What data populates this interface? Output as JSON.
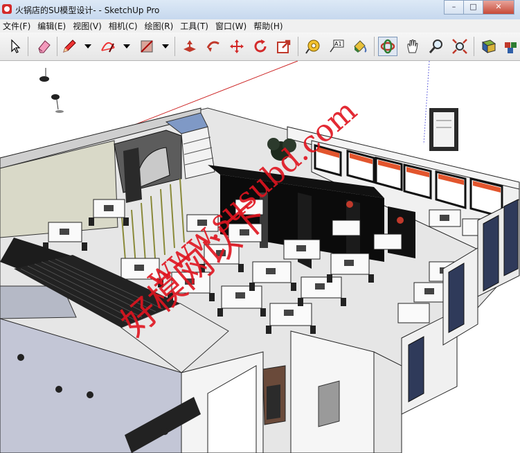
{
  "window": {
    "title": "火锅店的SU模型设计- - SketchUp Pro",
    "minimize_glyph": "–",
    "maximize_glyph": "□",
    "close_glyph": "✕"
  },
  "menu": [
    "文件(F)",
    "编辑(E)",
    "视图(V)",
    "相机(C)",
    "绘图(R)",
    "工具(T)",
    "窗口(W)",
    "帮助(H)"
  ],
  "toolbar": {
    "tools": [
      "select-icon",
      "eraser-icon",
      "pencil-icon",
      "arc-icon",
      "rectangle-icon",
      "push-pull-icon",
      "follow-me-icon",
      "move-icon",
      "rotate-icon",
      "offset-icon",
      "tape-measure-icon",
      "text-icon",
      "paint-bucket-icon",
      "orbit-icon",
      "pan-icon",
      "zoom-icon",
      "zoom-extents-icon",
      "components-icon",
      "warehouse-icon"
    ],
    "text_tool_label": "A1"
  },
  "watermark": {
    "line1": "好模网以下",
    "line2": "www.susubd.com"
  },
  "colors": {
    "title_bar": "#c6d8ee",
    "axis_red": "#cc2222",
    "watermark": "#e0141f",
    "floor": "#e6e6e6",
    "wall": "#ffffff",
    "partition": "#111111",
    "glass_wall": "#b8bcc8"
  }
}
